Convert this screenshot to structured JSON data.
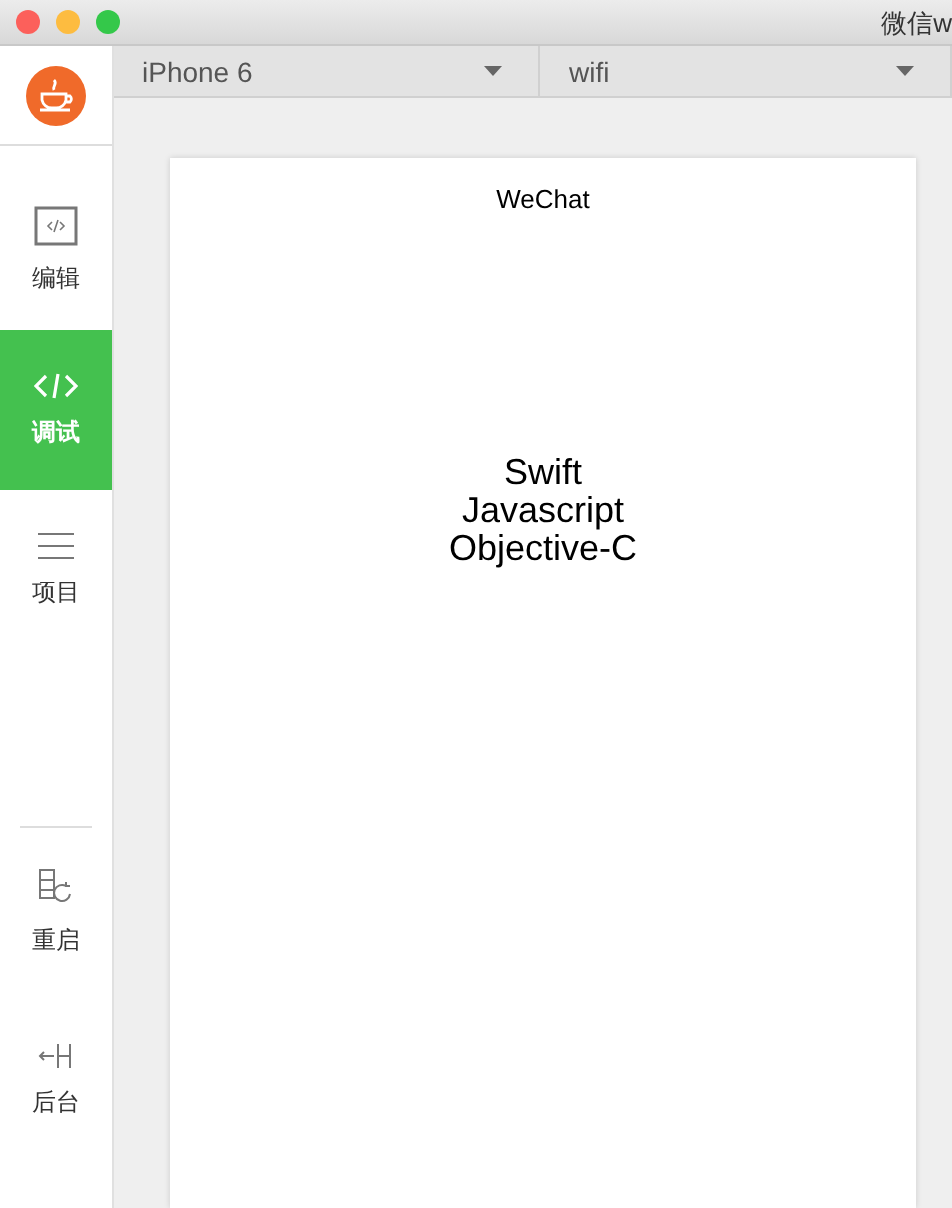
{
  "window": {
    "title": "微信w"
  },
  "sidebar": {
    "items": [
      {
        "kind": "edit",
        "label": "编辑",
        "selected": false
      },
      {
        "kind": "debug",
        "label": "调试",
        "selected": true
      },
      {
        "kind": "project",
        "label": "项目",
        "selected": false
      },
      {
        "kind": "restart",
        "label": "重启",
        "selected": false
      },
      {
        "kind": "background",
        "label": "后台",
        "selected": false
      }
    ]
  },
  "toolbar": {
    "device": "iPhone 6",
    "network": "wifi"
  },
  "preview": {
    "title": "WeChat",
    "lines": [
      "Swift",
      "Javascript",
      "Objective-C"
    ]
  }
}
